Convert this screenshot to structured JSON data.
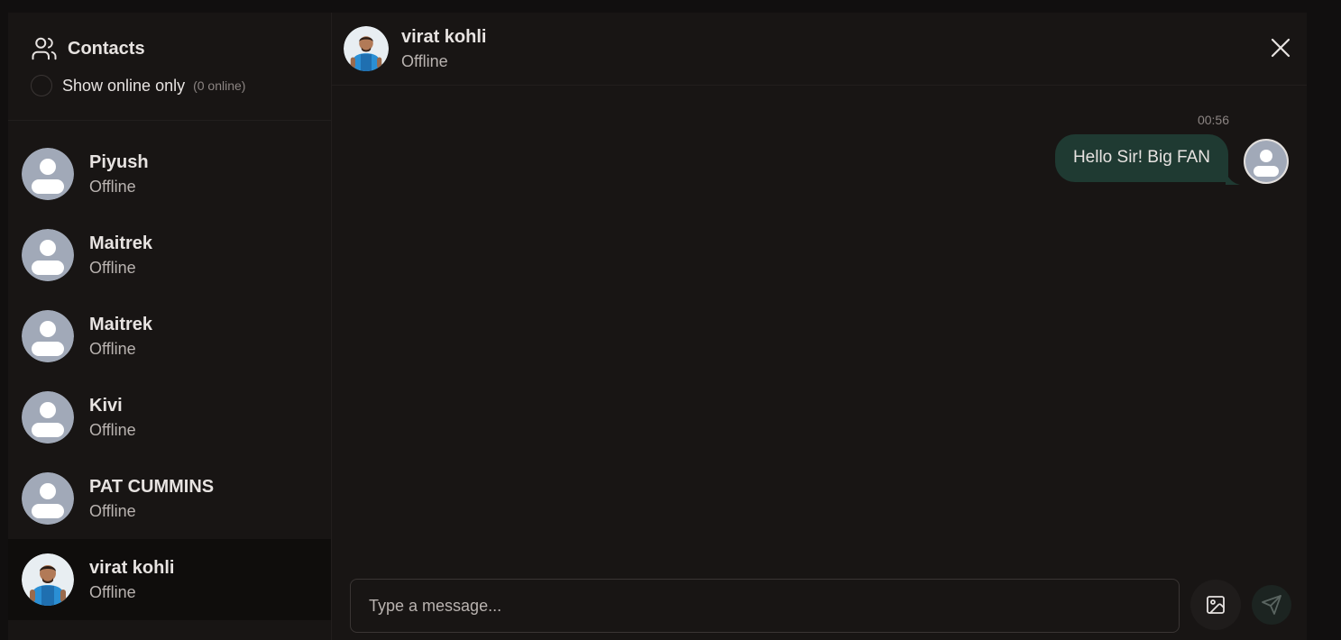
{
  "sidebar": {
    "title": "Contacts",
    "title_icon": "users-icon",
    "online_filter_label": "Show online only",
    "online_count": "(0 online)",
    "contacts": [
      {
        "name": "Piyush",
        "status": "Offline",
        "avatar": "default-avatar"
      },
      {
        "name": "Maitrek",
        "status": "Offline",
        "avatar": "default-avatar"
      },
      {
        "name": "Maitrek",
        "status": "Offline",
        "avatar": "default-avatar"
      },
      {
        "name": "Kivi",
        "status": "Offline",
        "avatar": "default-avatar"
      },
      {
        "name": "PAT CUMMINS",
        "status": "Offline",
        "avatar": "default-avatar"
      },
      {
        "name": "virat kohli",
        "status": "Offline",
        "avatar": "photo-avatar",
        "active": true
      }
    ]
  },
  "chat": {
    "name": "virat kohli",
    "status": "Offline",
    "close_icon": "close-icon",
    "messages": [
      {
        "time": "00:56",
        "text": "Hello Sir! Big FAN",
        "outgoing": true
      }
    ],
    "composer_placeholder": "Type a message...",
    "image_icon": "image-icon",
    "send_icon": "send-icon"
  },
  "colors": {
    "page_bg": "#110f0f",
    "panel_bg": "#181514",
    "bubble_bg": "#1f3a32",
    "text_primary": "#e7e3e1",
    "text_secondary": "#b9b3b0",
    "avatar_grey": "#a1a9b8"
  }
}
